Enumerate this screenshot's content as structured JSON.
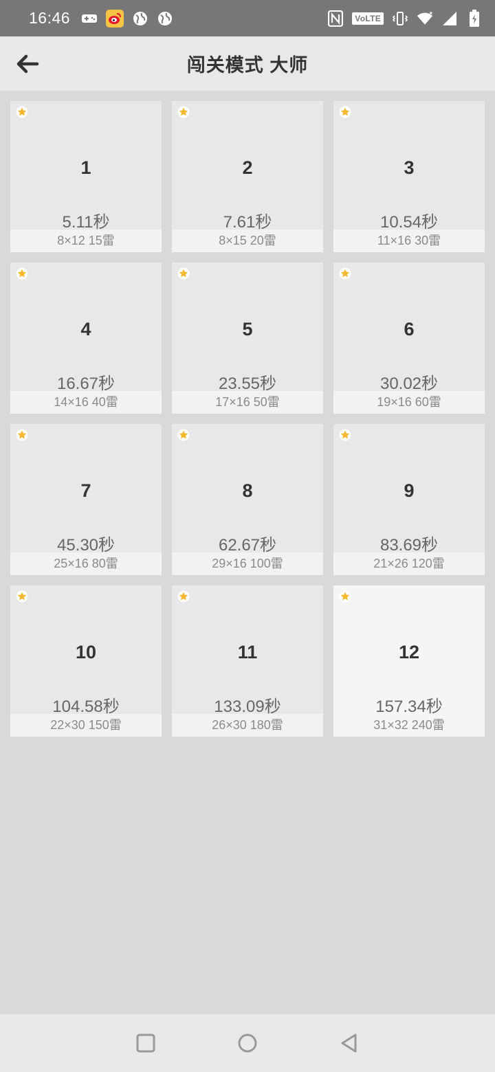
{
  "status_bar": {
    "time": "16:46",
    "volte": "VoLTE",
    "icons_left": [
      "gamepad-icon",
      "weibo-icon",
      "globe-icon",
      "globe-icon"
    ],
    "icons_right": [
      "nfc-icon",
      "volte-icon",
      "vibrate-icon",
      "wifi-icon",
      "signal-icon",
      "battery-icon"
    ]
  },
  "app_bar": {
    "back_icon": "arrow-left-icon",
    "title": "闯关模式 大师"
  },
  "levels": [
    {
      "number": "1",
      "time": "5.11秒",
      "info": "8×12  15雷"
    },
    {
      "number": "2",
      "time": "7.61秒",
      "info": "8×15  20雷"
    },
    {
      "number": "3",
      "time": "10.54秒",
      "info": "11×16  30雷"
    },
    {
      "number": "4",
      "time": "16.67秒",
      "info": "14×16  40雷"
    },
    {
      "number": "5",
      "time": "23.55秒",
      "info": "17×16  50雷"
    },
    {
      "number": "6",
      "time": "30.02秒",
      "info": "19×16  60雷"
    },
    {
      "number": "7",
      "time": "45.30秒",
      "info": "25×16  80雷"
    },
    {
      "number": "8",
      "time": "62.67秒",
      "info": "29×16  100雷"
    },
    {
      "number": "9",
      "time": "83.69秒",
      "info": "21×26  120雷"
    },
    {
      "number": "10",
      "time": "104.58秒",
      "info": "22×30  150雷"
    },
    {
      "number": "11",
      "time": "133.09秒",
      "info": "26×30  180雷"
    },
    {
      "number": "12",
      "time": "157.34秒",
      "info": "31×32  240雷"
    }
  ],
  "colors": {
    "star": "#f5b82e",
    "status_bar_bg": "#777777",
    "app_bar_bg": "#e8e8e8",
    "page_bg": "#d9d9d9"
  },
  "nav_bar": {
    "icons": [
      "square-icon",
      "circle-icon",
      "triangle-back-icon"
    ]
  }
}
